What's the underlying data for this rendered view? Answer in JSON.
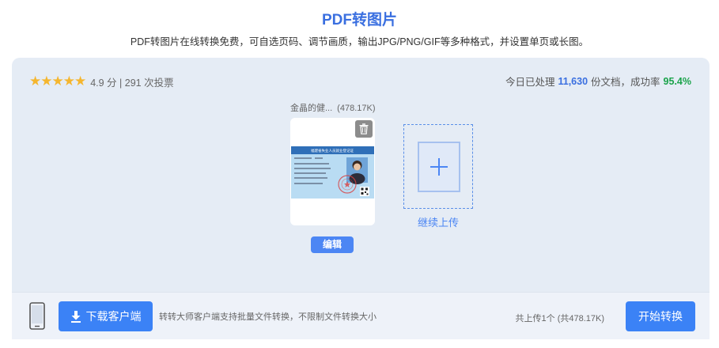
{
  "header": {
    "title": "PDF转图片",
    "subtitle": "PDF转图片在线转换免费，可自选页码、调节画质，输出JPG/PNG/GIF等多种格式，并设置单页或长图。"
  },
  "rating": {
    "stars": "★★★★★",
    "score_text": "4.9 分 | 291 次投票",
    "star_color": "#f5b62e"
  },
  "stats": {
    "prefix": "今日已处理",
    "processed": "11,630",
    "middle": "份文档，成功率",
    "success_rate": "95.4%"
  },
  "file": {
    "name": "金晶的健...",
    "size": "(478.17K)",
    "edit_label": "编辑",
    "thumb_header_text": "福建省失业人员就业登记证"
  },
  "upload": {
    "label": "继续上传"
  },
  "footer": {
    "download_label": "下载客户端",
    "tip": "转转大师客户端支持批量文件转换，不限制文件转换大小",
    "count": "共上传1个 (共478.17K)",
    "start_label": "开始转换"
  },
  "colors": {
    "accent": "#3b82f6",
    "title": "#3a6fe0",
    "success": "#1aa34a"
  }
}
